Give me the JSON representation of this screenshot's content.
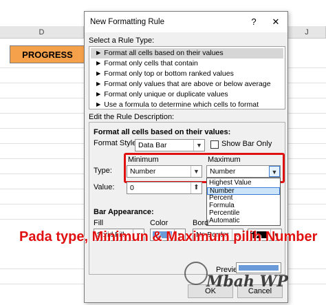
{
  "sheet": {
    "col_d": "D",
    "col_j": "J",
    "progress_header": "PROGRESS"
  },
  "dialog": {
    "title": "New Formatting Rule",
    "help_btn": "?",
    "close_btn": "✕",
    "select_rule_type_label": "Select a Rule Type:",
    "rule_types": [
      "► Format all cells based on their values",
      "► Format only cells that contain",
      "► Format only top or bottom ranked values",
      "► Format only values that are above or below average",
      "► Format only unique or duplicate values",
      "► Use a formula to determine which cells to format"
    ],
    "edit_rule_label": "Edit the Rule Description:",
    "format_all_label": "Format all cells based on their values:",
    "format_style_label": "Format Style:",
    "format_style_value": "Data Bar",
    "show_bar_only_label": "Show Bar Only",
    "minimum_label": "Minimum",
    "maximum_label": "Maximum",
    "type_label": "Type:",
    "min_type_value": "Number",
    "max_type_value": "Number",
    "value_label": "Value:",
    "min_value": "0",
    "dropdown_options": [
      "Highest Value",
      "Number",
      "Percent",
      "Formula",
      "Percentile",
      "Automatic"
    ],
    "dropdown_selected_index": 1,
    "bar_appearance_label": "Bar Appearance:",
    "fill_label": "Fill",
    "color_label": "Color",
    "border_label": "Bord",
    "fill_value": "Solid Fill",
    "border_value": "No Border",
    "preview_label": "Preview:",
    "ok_btn": "OK",
    "cancel_btn": "Cancel"
  },
  "colors": {
    "accent_red": "#e01010",
    "bar_color": "#6a9ad8",
    "progress_fill": "#f5a04a"
  },
  "overlay": {
    "caption": "Pada type, Minimun & Maximum pilih Number",
    "watermark": "Mbah WP"
  }
}
